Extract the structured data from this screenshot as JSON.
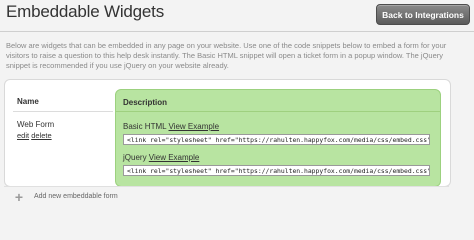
{
  "header": {
    "title": "Embeddable Widgets",
    "back_button": "Back to Integrations"
  },
  "intro_text": "Below are widgets that can be embedded in any page on your website. Use one of the code snippets below to embed a form for your visitors to raise a question to this help desk instantly. The Basic HTML snippet will open a ticket form in a popup window. The jQuery snippet is recommended if you use jQuery on your website already.",
  "table": {
    "columns": {
      "name": "Name",
      "description": "Description"
    },
    "rows": [
      {
        "name": "Web Form",
        "edit_label": "edit",
        "delete_label": "delete",
        "snippets": [
          {
            "label": "Basic HTML",
            "link": "View Example",
            "code": "<link rel=\"stylesheet\" href=\"https://rahulten.happyfox.com/media/css/embed.css\" ty"
          },
          {
            "label": "jQuery",
            "link": "View Example",
            "code": "<link rel=\"stylesheet\" href=\"https://rahulten.happyfox.com/media/css/embed.css\" ty"
          }
        ]
      }
    ]
  },
  "add_widget": {
    "label": "Add new embeddable form",
    "icon": "plus-icon"
  },
  "colors": {
    "description_bg": "#b8e4a1",
    "button_bg": "#6e6e6e"
  }
}
